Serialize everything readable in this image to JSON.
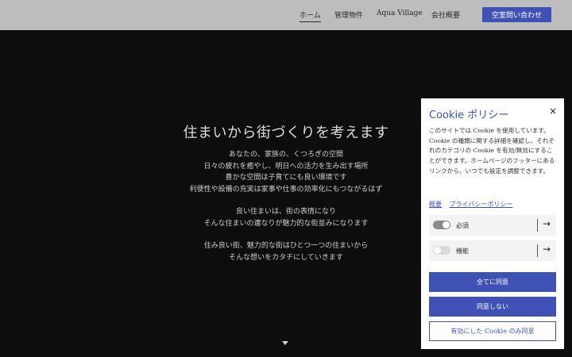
{
  "header": {
    "nav": [
      {
        "label": "ホーム",
        "active": true
      },
      {
        "label": "管理物件",
        "active": false
      },
      {
        "label": "Aqua Village",
        "active": false
      },
      {
        "label": "会社概要",
        "active": false
      }
    ],
    "cta_label": "空室問い合わせ"
  },
  "hero": {
    "title": "住まいから街づくりを考えます",
    "lines": [
      "あなたの、家族の、くつろぎの空間",
      "日々の疲れを癒やし、明日への活力を生み出す場所",
      "豊かな空間は子育てにも良い環境です",
      "利便性や設備の充実は家事や仕事の効率化にもつながるはず",
      "",
      "良い住まいは、街の表情になり",
      "そんな住まいの連なりが魅力的な街並みになります",
      "",
      "住み良い街、魅力的な街はひとつ一つの住まいから",
      "そんな想いをカタチにしていきます"
    ]
  },
  "cookie": {
    "title": "Cookie ポリシー",
    "close": "×",
    "body": "このサイトでは Cookie を使用しています。Cookie の種類に関する詳細を確認し、それぞれのカテゴリの Cookie を有効/無効にすることができます。ホームページのフッターにあるリンクから、いつでも設定を調整できます。",
    "links": [
      "概要",
      "プライバシーポリシー"
    ],
    "toggles": [
      {
        "label": "必須",
        "on": true,
        "arrow": "→"
      },
      {
        "label": "機能",
        "on": false,
        "arrow": "→"
      }
    ],
    "buttons": {
      "accept_all": "全てに同意",
      "reject": "同意しない",
      "accept_enabled": "有効にした Cookie のみ同意"
    }
  },
  "colors": {
    "accent": "#3f51b5",
    "header_bg": "#bdbdbd",
    "page_bg": "#0d0d0f"
  }
}
